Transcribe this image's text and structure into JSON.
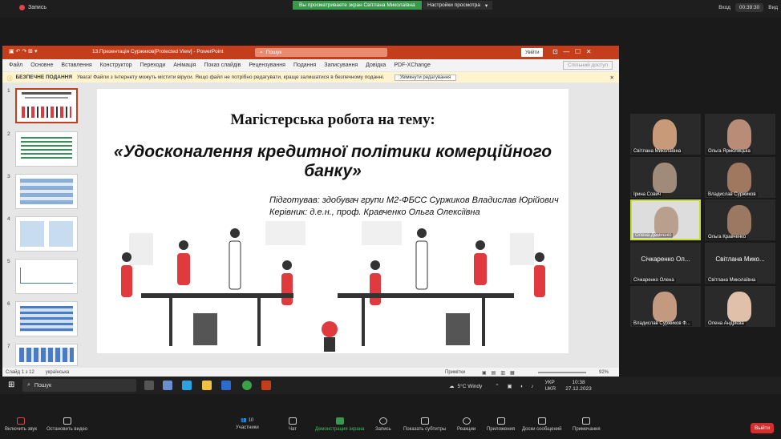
{
  "zoom_top": {
    "recording": "Запись",
    "share_notice": "Вы просматриваете экран Світлана Миколаївна",
    "view_options": "Настройки просмотра",
    "enter": "Вход",
    "timer": "00:39:30",
    "view": "Вид"
  },
  "ppt": {
    "title": "13.Презентація Суржиков[Protected View] - PowerPoint",
    "search": "Пошук",
    "signin": "Увійти",
    "menu": [
      "Файл",
      "Основне",
      "Вставлення",
      "Конструктор",
      "Переходи",
      "Анімація",
      "Показ слайдів",
      "Рецензування",
      "Подання",
      "Записування",
      "Довідка",
      "PDF-XChange"
    ],
    "share": "Спільний доступ",
    "msg_title": "БЕЗПЕЧНЕ ПОДАННЯ",
    "msg_text": "Увага! Файли з Інтернету можуть містити віруси. Якщо файл не потрібно редагувати, краще залишатися в безпечному поданні.",
    "msg_button": "Увімкнути редагування",
    "thumbs": [
      "1",
      "2",
      "3",
      "4",
      "5",
      "6",
      "7"
    ],
    "slide": {
      "heading": "Магістерська робота на тему:",
      "topic": "«Удосконалення кредитної політики комерційного банку»",
      "author": "Підготував: здобувач групи М2-ФБСС Суржиков Владислав Юрійович",
      "advisor": "Керівник: д.е.н., проф. Кравченко Ольга Олексіївна"
    },
    "status_left": "Слайд 1 з 12",
    "status_lang": "українська",
    "notes": "Примітки",
    "zoom": "92%"
  },
  "taskbar": {
    "search": "Пошук",
    "weather": "5°C Windy",
    "lang1": "УКР",
    "lang2": "UKR",
    "time": "10:38",
    "date": "27.12.2023"
  },
  "participants": [
    {
      "name": "Світлана Миколаївна"
    },
    {
      "name": "Ольга Ярмолицька"
    },
    {
      "name": "Ірина Сович"
    },
    {
      "name": "Владислав Суржиков"
    },
    {
      "name": "Олена Демишко"
    },
    {
      "name": "Ольга Кравченко"
    },
    {
      "name": "Січкаренко Олена",
      "big": "Січкаренко Ол..."
    },
    {
      "name": "Світлана Миколаївна",
      "big": "Світлана Мико..."
    },
    {
      "name": "Владислав Суржиков Ф..."
    },
    {
      "name": "Олена Андрієва"
    }
  ],
  "zoom_bottom": {
    "mute": "Включить звук",
    "video": "Остановить видео",
    "participants": "Участники",
    "participants_count": "10",
    "chat": "Чат",
    "share": "Демонстрация экрана",
    "record": "Запись",
    "subtitles": "Показать субтитры",
    "reactions": "Реакции",
    "apps": "Приложения",
    "whiteboards": "Доски сообщений",
    "notes": "Примечания",
    "leave": "Выйти"
  },
  "colors": {
    "ppt_accent": "#c43e1c",
    "share_green": "#3a9a4c",
    "slide_red": "#e03a3e",
    "leave_red": "#d32f2f"
  }
}
